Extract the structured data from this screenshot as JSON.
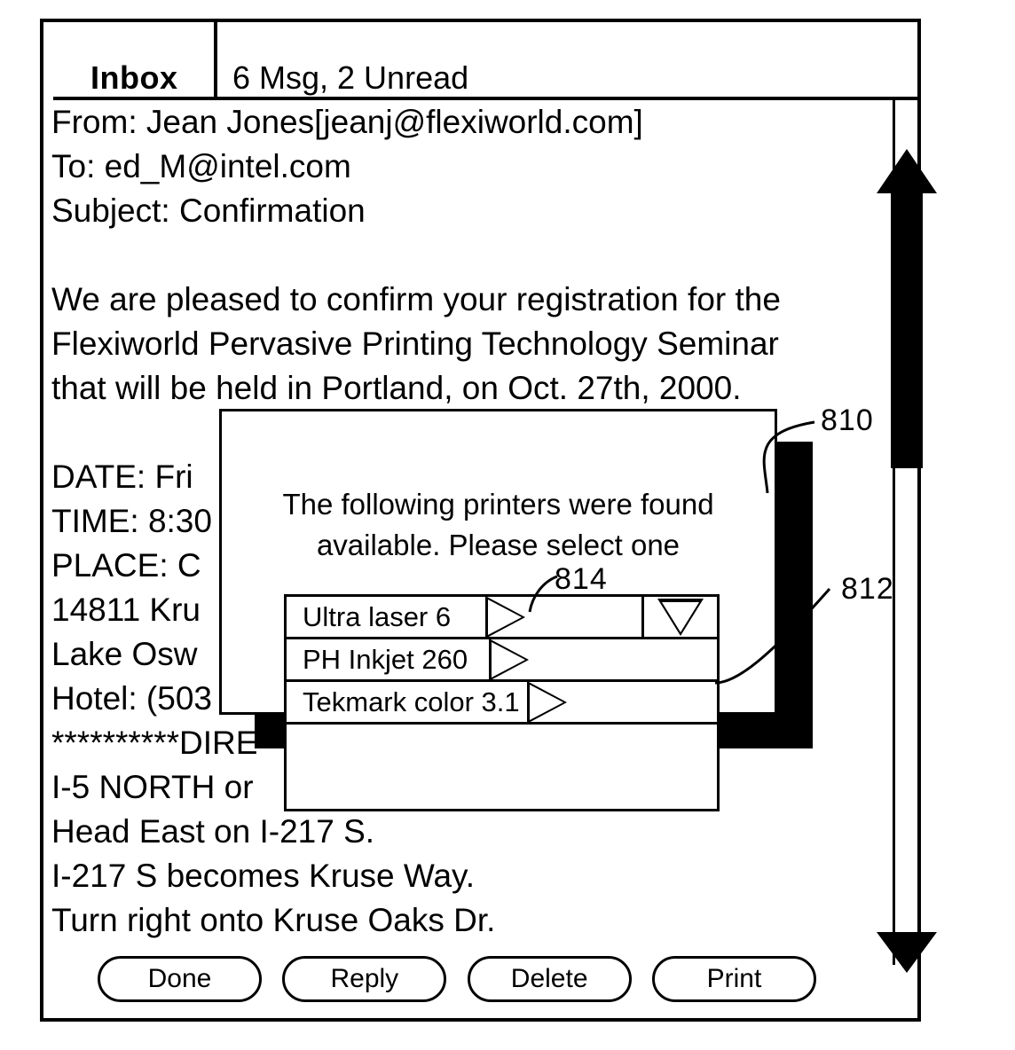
{
  "header": {
    "tab_label": "Inbox",
    "status_label": "6 Msg, 2 Unread"
  },
  "message": {
    "from_line": "From: Jean Jones[jeanj@flexiworld.com]",
    "to_line": "To: ed_M@intel.com",
    "subject_line": "Subject: Confirmation",
    "body_lines": [
      "We are pleased to confirm your registration for the",
      "Flexiworld Pervasive Printing Technology Seminar",
      "that will be held in Portland, on Oct. 27th, 2000.",
      "",
      "DATE: Fri",
      "TIME: 8:30",
      "PLACE: C",
      "14811 Kru",
      "Lake Osw",
      "Hotel: (503",
      "**********DIRE",
      "I-5 NORTH or",
      "Head East on I-217 S.",
      "I-217 S becomes Kruse Way.",
      "Turn right onto Kruse Oaks Dr."
    ]
  },
  "dialog": {
    "prompt_line_1": "The following printers were found",
    "prompt_line_2": "available.  Please select one",
    "printers": [
      {
        "name": "Ultra laser 6"
      },
      {
        "name": "PH Inkjet 260"
      },
      {
        "name": "Tekmark color 3.1"
      }
    ]
  },
  "reference_numerals": {
    "dialog_ref": "810",
    "shadow_ref": "812",
    "select_arrow_ref": "814"
  },
  "buttons": [
    {
      "label": "Done"
    },
    {
      "label": "Reply"
    },
    {
      "label": "Delete"
    },
    {
      "label": "Print"
    }
  ]
}
